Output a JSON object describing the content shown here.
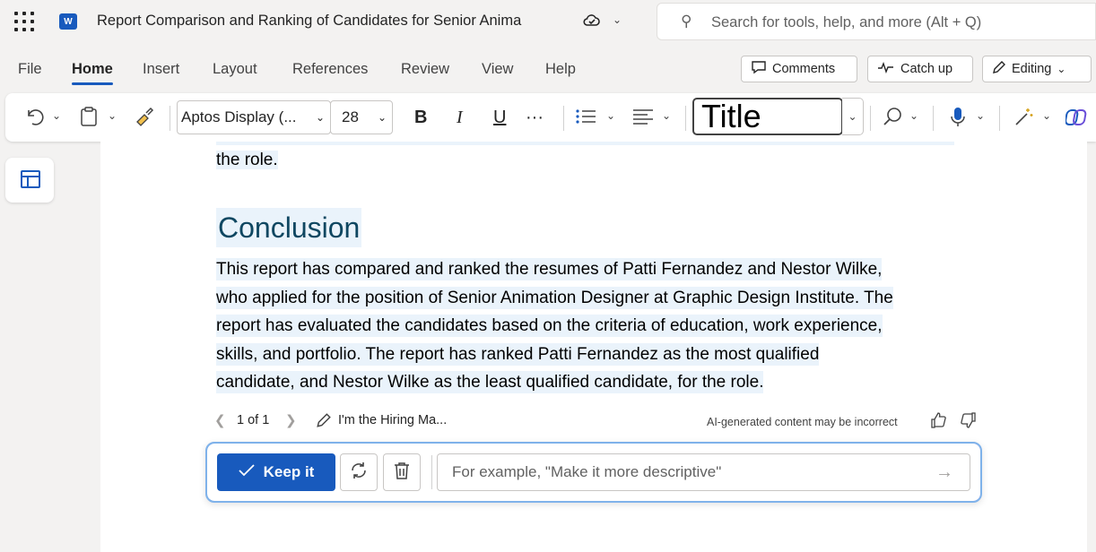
{
  "app": {
    "logo_letter": "W",
    "doc_title": "Report Comparison and Ranking of Candidates for Senior Anima",
    "search_placeholder": "Search for tools, help, and more (Alt + Q)"
  },
  "menu": {
    "tabs": [
      "File",
      "Home",
      "Insert",
      "Layout",
      "References",
      "Review",
      "View",
      "Help"
    ],
    "active_tab": "Home",
    "comments_label": "Comments",
    "catchup_label": "Catch up",
    "editing_label": "Editing"
  },
  "ribbon": {
    "font_name": "Aptos Display (...",
    "font_size": "28",
    "bold": "B",
    "italic": "I",
    "underline": "U",
    "more": "···",
    "style_name": "Title"
  },
  "document": {
    "previous_tail": "the role.",
    "heading": "Conclusion",
    "paragraph_lines": [
      "This report has compared and ranked the resumes of Patti Fernandez and Nestor Wilke,",
      "who applied for the position of Senior Animation Designer at Graphic Design Institute. The",
      "report has evaluated the candidates based on the criteria of education, work experience,",
      "skills, and portfolio. The report has ranked Patti Fernandez as the most qualified",
      "candidate, and Nestor Wilke as the least qualified candidate, for the role."
    ]
  },
  "ai": {
    "pager": "1 of 1",
    "prompt_summary": "I'm the Hiring Ma...",
    "disclaimer": "AI-generated content may be incorrect",
    "keep_label": "Keep it",
    "input_placeholder": "For example, \"Make it more descriptive\""
  },
  "colors": {
    "accent": "#185abd",
    "heading": "#0f4761",
    "highlight": "#eaf3fb"
  }
}
